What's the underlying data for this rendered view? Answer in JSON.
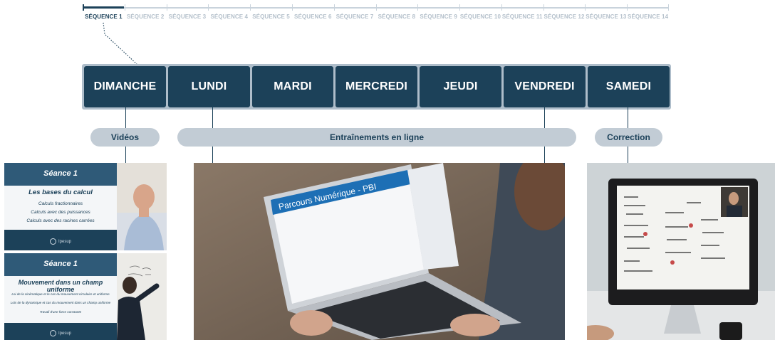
{
  "sequences": {
    "items": [
      "SÉQUENCE 1",
      "SÉQUENCE 2",
      "SÉQUENCE 3",
      "SÉQUENCE 4",
      "SÉQUENCE 5",
      "SÉQUENCE 6",
      "SÉQUENCE 7",
      "SÉQUENCE 8",
      "SÉQUENCE 9",
      "SÉQUENCE 10",
      "SÉQUENCE 11",
      "SÉQUENCE 12",
      "SÉQUENCE 13",
      "SÉQUENCE 14"
    ],
    "active_index": 0
  },
  "days": [
    "DIMANCHE",
    "LUNDI",
    "MARDI",
    "MERCREDI",
    "JEUDI",
    "VENDREDI",
    "SAMEDI"
  ],
  "categories": {
    "videos": "Vidéos",
    "training": "Entraînements en ligne",
    "correction": "Correction"
  },
  "video1": {
    "seance": "Séance 1",
    "title": "Les bases du calcul",
    "items": [
      "Calculs fractionnaires",
      "Calculs avec des puissances",
      "Calculs avec des racines carrées"
    ],
    "logo": "Ipesup"
  },
  "video2": {
    "seance": "Séance 1",
    "title": "Mouvement dans un champ uniforme",
    "items": [
      "Loi de la cinématique et le cas du mouvement circulaire et uniforme",
      "Lois de la dynamique et cas du mouvement dans un champ uniforme",
      "Travail d'une force constante"
    ],
    "logo": "Ipesup"
  },
  "laptop": {
    "screen_title": "Parcours Numérique - PBI"
  },
  "colors": {
    "navy": "#1c4159",
    "pill": "#c2ccd5",
    "inactive_seq": "#b4c0cb"
  },
  "icons": {
    "logo": "ipesup-logo-icon"
  }
}
